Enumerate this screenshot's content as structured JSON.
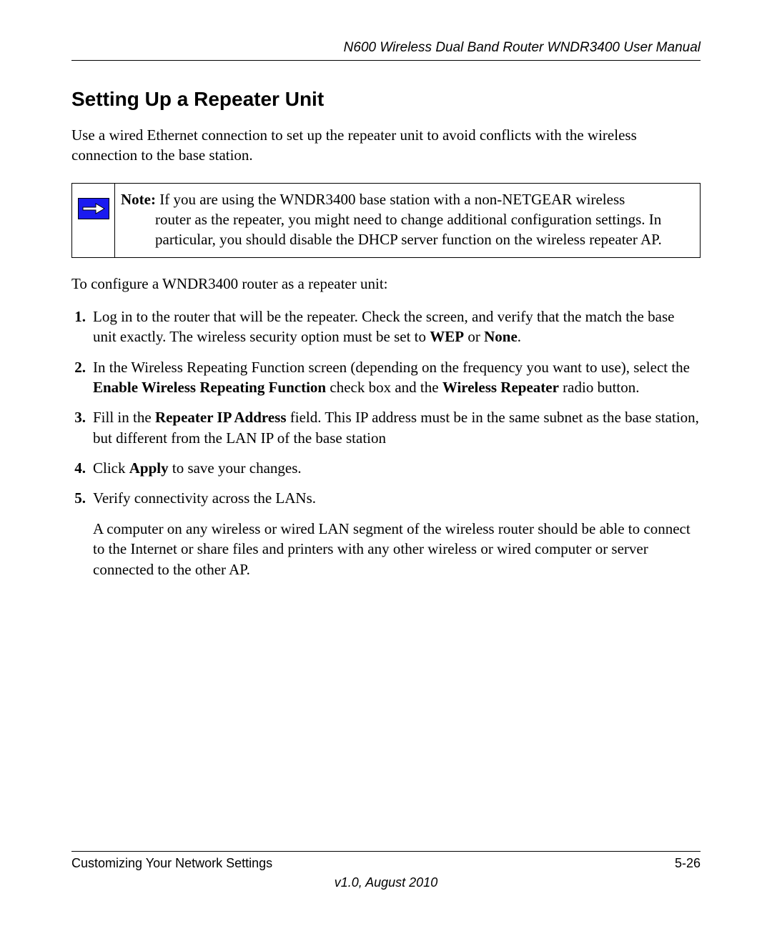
{
  "header": {
    "doc_title": "N600 Wireless Dual Band Router WNDR3400 User Manual"
  },
  "section": {
    "title": "Setting Up a Repeater Unit",
    "intro": "Use a wired Ethernet connection to set up the repeater unit to avoid conflicts with the wireless connection to the base station."
  },
  "note": {
    "label": "Note:",
    "line1": " If you are using the WNDR3400 base station with a non-NETGEAR wireless ",
    "cont": "router as the repeater, you might need to change additional configuration settings. In particular, you should disable the DHCP server function on the wireless repeater AP."
  },
  "lead": "To configure a WNDR3400 router as a repeater unit:",
  "steps": [
    {
      "num": "1.",
      "pre": "Log in to the router that will be the repeater. Check the  screen, and verify that the  match the base unit exactly. The wireless security option must be set to ",
      "b1": "WEP",
      "mid1": " or ",
      "b2": "None",
      "post": "."
    },
    {
      "num": "2.",
      "pre": "In the Wireless Repeating Function screen (depending on the frequency you want to use), select the ",
      "b1": "Enable Wireless Repeating Function",
      "mid1": " check box and the ",
      "b2": "Wireless Repeater",
      "post": " radio button."
    },
    {
      "num": "3.",
      "pre": "Fill in the ",
      "b1": "Repeater IP Address",
      "mid1": " field. This IP address must be in the same subnet as the base station, but different from the LAN IP of the base station",
      "b2": "",
      "post": ""
    },
    {
      "num": "4.",
      "pre": "Click ",
      "b1": "Apply",
      "mid1": " to save your changes.",
      "b2": "",
      "post": ""
    },
    {
      "num": "5.",
      "pre": "Verify connectivity across the LANs.",
      "b1": "",
      "mid1": "",
      "b2": "",
      "post": "",
      "sub": "A computer on any wireless or wired LAN segment of the wireless router should be able to connect to the Internet or share files and printers with any other wireless or wired computer or server connected to the other AP."
    }
  ],
  "footer": {
    "left": "Customizing Your Network Settings",
    "right": "5-26",
    "version": "v1.0, August 2010"
  }
}
